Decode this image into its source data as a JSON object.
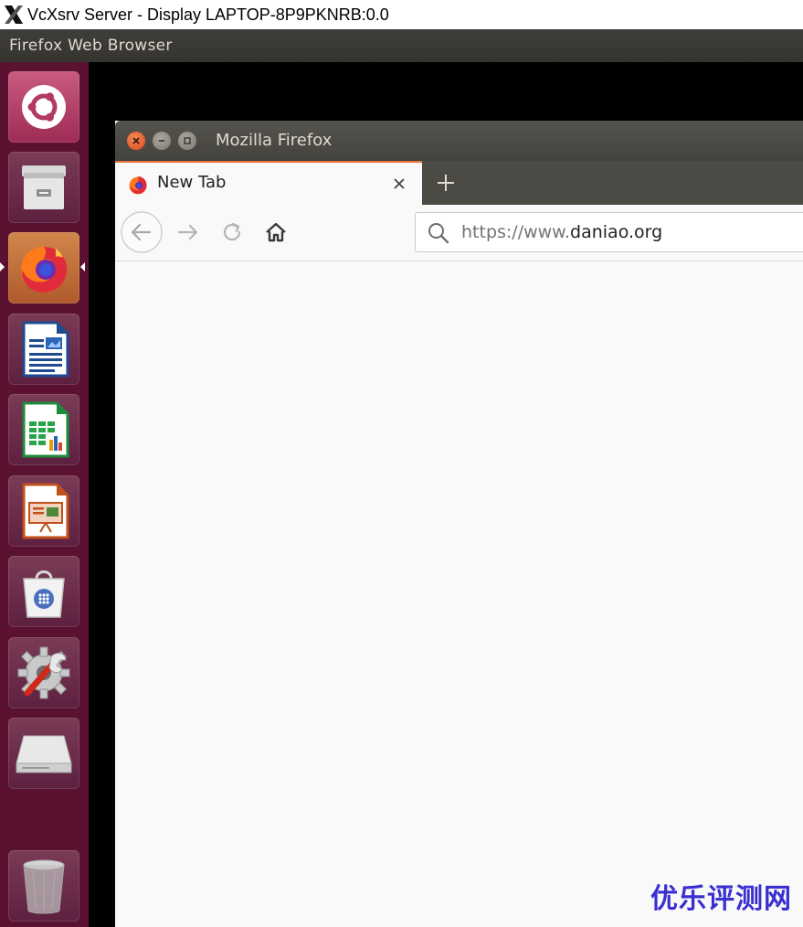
{
  "host_window": {
    "title": "VcXsrv Server - Display LAPTOP-8P9PKNRB:0.0"
  },
  "top_panel": {
    "app_title": "Firefox Web Browser"
  },
  "launcher": {
    "items": [
      {
        "name": "dash-home",
        "icon": "ubuntu-logo-icon"
      },
      {
        "name": "files",
        "icon": "file-cabinet-icon"
      },
      {
        "name": "firefox",
        "icon": "firefox-icon",
        "active": true
      },
      {
        "name": "libreoffice-writer",
        "icon": "writer-document-icon"
      },
      {
        "name": "libreoffice-calc",
        "icon": "calc-spreadsheet-icon"
      },
      {
        "name": "libreoffice-impress",
        "icon": "impress-presentation-icon"
      },
      {
        "name": "software-center",
        "icon": "shopping-bag-icon"
      },
      {
        "name": "system-settings",
        "icon": "gear-wrench-icon"
      },
      {
        "name": "drive",
        "icon": "drive-icon"
      },
      {
        "name": "trash",
        "icon": "trash-icon"
      }
    ]
  },
  "firefox": {
    "window_title": "Mozilla Firefox",
    "tab": {
      "label": "New Tab"
    },
    "urlbar": {
      "prefix": "https://www.",
      "domain": "daniao.org"
    }
  },
  "watermark": {
    "text": "优乐评测网"
  },
  "colors": {
    "launcher_bg": "#5a1230",
    "tab_accent": "#e8743c",
    "watermark": "#3a2fd1"
  }
}
